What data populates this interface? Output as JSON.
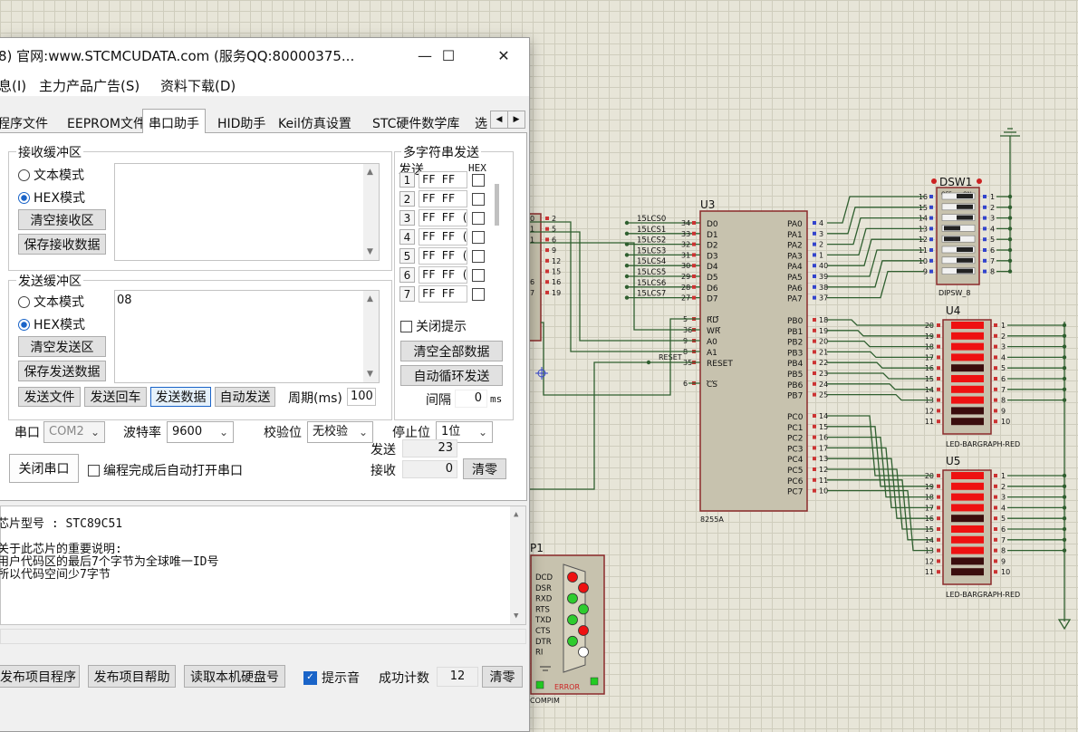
{
  "window": {
    "title": "8) 官网:www.STCMCUDATA.com  (服务QQ:80000375...",
    "controls": {
      "minimize": "—",
      "maximize": "☐",
      "close": "✕"
    }
  },
  "menu": [
    "息(I)",
    "主力产品广告(S)",
    "资料下载(D)"
  ],
  "tabs": [
    "程序文件",
    "EEPROM文件",
    "串口助手",
    "HID助手",
    "Keil仿真设置",
    "STC硬件数学库",
    "选"
  ],
  "tab_scroll": {
    "left": "◀",
    "right": "▶"
  },
  "receive": {
    "title": "接收缓冲区",
    "mode_text": "文本模式",
    "mode_hex": "HEX模式",
    "clear_btn": "清空接收区",
    "save_btn": "保存接收数据",
    "content": ""
  },
  "send": {
    "title": "发送缓冲区",
    "mode_text": "文本模式",
    "mode_hex": "HEX模式",
    "clear_btn": "清空发送区",
    "save_btn": "保存发送数据",
    "content": "08"
  },
  "multi": {
    "title": "多字符串发送",
    "col_send": "发送",
    "col_hex": "HEX",
    "rows": [
      {
        "num": "1",
        "value": "FF FF"
      },
      {
        "num": "2",
        "value": "FF FF"
      },
      {
        "num": "3",
        "value": "FF FF ("
      },
      {
        "num": "4",
        "value": "FF FF ("
      },
      {
        "num": "5",
        "value": "FF FF ("
      },
      {
        "num": "6",
        "value": "FF FF ("
      },
      {
        "num": "7",
        "value": "FF FF"
      }
    ],
    "close_hint": "关闭提示",
    "clear_all": "清空全部数据",
    "auto_loop": "自动循环发送",
    "interval_label": "间隔",
    "interval_value": "0",
    "interval_unit": "ms"
  },
  "actions": {
    "send_file": "发送文件",
    "send_enter": "发送回车",
    "send_data": "发送数据",
    "auto_send": "自动发送",
    "period_label": "周期(ms)",
    "period_value": "100"
  },
  "port": {
    "port_label": "串口",
    "port_value": "COM2",
    "baud_label": "波特率",
    "baud_value": "9600",
    "parity_label": "校验位",
    "parity_value": "无校验",
    "stop_label": "停止位",
    "stop_value": "1位",
    "close_btn": "关闭串口",
    "auto_open": "编程完成后自动打开串口",
    "sent_label": "发送",
    "sent_value": "23",
    "recv_label": "接收",
    "recv_value": "0",
    "clear_btn": "清零"
  },
  "info": {
    "lines": [
      "芯片型号 : STC89C51",
      "",
      "关于此芯片的重要说明:",
      "  用户代码区的最后7个字节为全球唯一ID号",
      "  所以代码空间少7字节"
    ]
  },
  "bottom": {
    "publish": "发布项目程序",
    "publish_help": "发布项目帮助",
    "read_disk": "读取本机硬盘号",
    "beep": "提示音",
    "count_label": "成功计数",
    "count_value": "12",
    "clear_btn": "清零"
  },
  "schematic": {
    "u3": {
      "ref": "U3",
      "part": "8255A",
      "left_pins": [
        {
          "net": "15LCS0",
          "num": "34",
          "name": "D0"
        },
        {
          "net": "15LCS1",
          "num": "33",
          "name": "D1"
        },
        {
          "net": "15LCS2",
          "num": "32",
          "name": "D2"
        },
        {
          "net": "15LCS3",
          "num": "31",
          "name": "D3"
        },
        {
          "net": "15LCS4",
          "num": "30",
          "name": "D4"
        },
        {
          "net": "15LCS5",
          "num": "29",
          "name": "D5"
        },
        {
          "net": "15LCS6",
          "num": "28",
          "name": "D6"
        },
        {
          "net": "15LCS7",
          "num": "27",
          "name": "D7"
        }
      ],
      "ctrl_pins": [
        {
          "num": "5",
          "name": "RD"
        },
        {
          "num": "36",
          "name": "WR"
        },
        {
          "num": "9",
          "name": "A0"
        },
        {
          "num": "8",
          "name": "A1"
        },
        {
          "num": "35",
          "name": "RESET"
        },
        {
          "num": "6",
          "name": "CS"
        }
      ],
      "reset_net": "RESET",
      "pa": [
        {
          "name": "PA0",
          "num": "4"
        },
        {
          "name": "PA1",
          "num": "3"
        },
        {
          "name": "PA2",
          "num": "2"
        },
        {
          "name": "PA3",
          "num": "1"
        },
        {
          "name": "PA4",
          "num": "40"
        },
        {
          "name": "PA5",
          "num": "39"
        },
        {
          "name": "PA6",
          "num": "38"
        },
        {
          "name": "PA7",
          "num": "37"
        }
      ],
      "pb": [
        {
          "name": "PB0",
          "num": "18"
        },
        {
          "name": "PB1",
          "num": "19"
        },
        {
          "name": "PB2",
          "num": "20"
        },
        {
          "name": "PB3",
          "num": "21"
        },
        {
          "name": "PB4",
          "num": "22"
        },
        {
          "name": "PB5",
          "num": "23"
        },
        {
          "name": "PB6",
          "num": "24"
        },
        {
          "name": "PB7",
          "num": "25"
        }
      ],
      "pc": [
        {
          "name": "PC0",
          "num": "14"
        },
        {
          "name": "PC1",
          "num": "15"
        },
        {
          "name": "PC2",
          "num": "16"
        },
        {
          "name": "PC3",
          "num": "17"
        },
        {
          "name": "PC4",
          "num": "13"
        },
        {
          "name": "PC5",
          "num": "12"
        },
        {
          "name": "PC6",
          "num": "11"
        },
        {
          "name": "PC7",
          "num": "10"
        }
      ]
    },
    "left_ic_pins": [
      "2",
      "5",
      "6",
      "9",
      "12",
      "15",
      "16",
      "19"
    ],
    "left_ic_partial": [
      "0",
      "1",
      "1",
      "",
      "",
      "",
      "6",
      "7"
    ],
    "dsw": {
      "ref": "DSW1",
      "part": "DIPSW_8",
      "off": "OFF",
      "on": "ON",
      "left_pins": [
        "16",
        "15",
        "14",
        "13",
        "12",
        "11",
        "10",
        "9"
      ],
      "right_pins": [
        "1",
        "2",
        "3",
        "4",
        "5",
        "6",
        "7",
        "8"
      ],
      "switch_on": [
        true,
        true,
        true,
        false,
        false,
        true,
        true,
        true
      ]
    },
    "u4": {
      "ref": "U4",
      "part": "LED-BARGRAPH-RED",
      "left_pins": [
        "20",
        "19",
        "18",
        "17",
        "16",
        "15",
        "14",
        "13",
        "12",
        "11"
      ],
      "right_pins": [
        "1",
        "2",
        "3",
        "4",
        "5",
        "6",
        "7",
        "8",
        "9",
        "10"
      ],
      "lit": [
        true,
        true,
        true,
        true,
        false,
        true,
        true,
        true,
        false,
        false
      ]
    },
    "u5": {
      "ref": "U5",
      "part": "LED-BARGRAPH-RED",
      "left_pins": [
        "20",
        "19",
        "18",
        "17",
        "16",
        "15",
        "14",
        "13",
        "12",
        "11"
      ],
      "right_pins": [
        "1",
        "2",
        "3",
        "4",
        "5",
        "6",
        "7",
        "8",
        "9",
        "10"
      ],
      "lit": [
        true,
        true,
        true,
        true,
        false,
        true,
        true,
        true,
        false,
        false
      ]
    },
    "p1": {
      "ref": "P1",
      "part": "COMPIM",
      "error": "ERROR",
      "signals": [
        "DCD",
        "DSR",
        "RXD",
        "RTS",
        "TXD",
        "CTS",
        "DTR",
        "RI"
      ],
      "led_colors": [
        "red",
        "red",
        "green",
        "green",
        "green",
        "red",
        "green",
        "white"
      ]
    },
    "colors": {
      "wire": "#2f5f2f",
      "chip": "#c7c2ae",
      "chip_border": "#8b2a2a",
      "pin_red": "#cc3333",
      "pin_blue": "#3344cc",
      "led_on": "#ee1111",
      "led_off": "#3a0d0d"
    }
  }
}
